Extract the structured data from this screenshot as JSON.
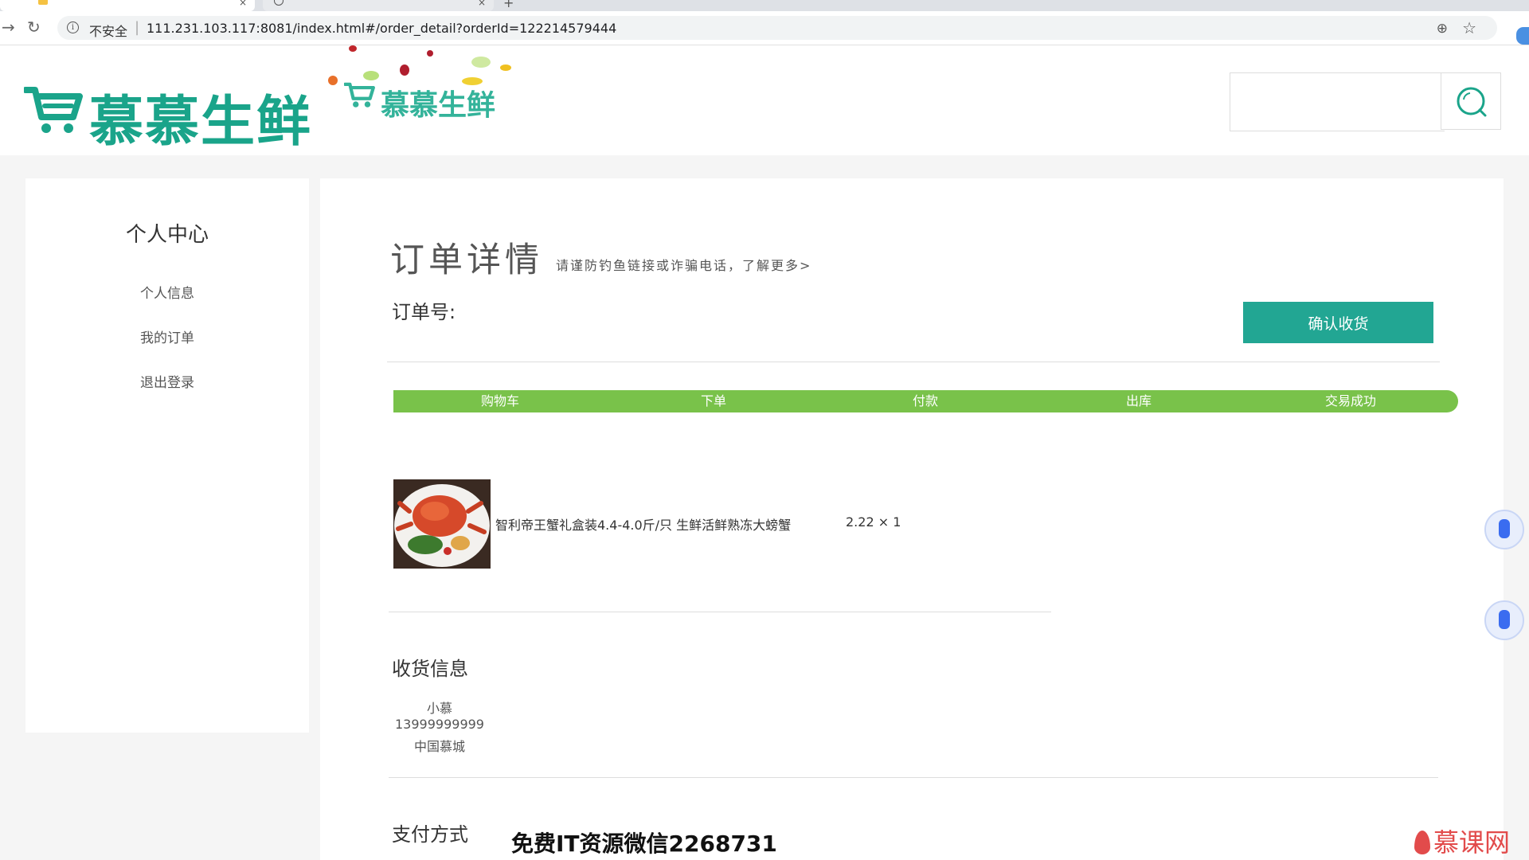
{
  "browser": {
    "security_label": "不安全",
    "url_host": "111.231.103.117",
    "url_path": ":8081/index.html#/order_detail?orderId=122214579444"
  },
  "header": {
    "logo_text": "慕慕生鲜",
    "logo_small_text": "慕慕生鲜",
    "search_placeholder": ""
  },
  "sidebar": {
    "title": "个人中心",
    "items": [
      {
        "label": "个人信息"
      },
      {
        "label": "我的订单"
      },
      {
        "label": "退出登录"
      }
    ]
  },
  "order": {
    "title": "订单详情",
    "tip": "请谨防钓鱼链接或诈骗电话，了解更多>",
    "order_no_label": "订单号:",
    "confirm_label": "确认收货",
    "steps": [
      "购物车",
      "下单",
      "付款",
      "出库",
      "交易成功"
    ],
    "product": {
      "name": "智利帝王蟹礼盒装4.4-4.0斤/只 生鲜活鲜熟冻大螃蟹",
      "price_qty": "2.22 × 1"
    },
    "receiver_title": "收货信息",
    "receiver": {
      "name": "小慕",
      "phone": "13999999999",
      "address": "中国慕城"
    },
    "payment_title": "支付方式"
  },
  "overlay": {
    "watermark": "免费IT资源微信2268731",
    "brand": "慕课网"
  },
  "colors": {
    "brand_green": "#1aa48a",
    "button_teal": "#22a693",
    "progress_green": "#79c24a"
  }
}
